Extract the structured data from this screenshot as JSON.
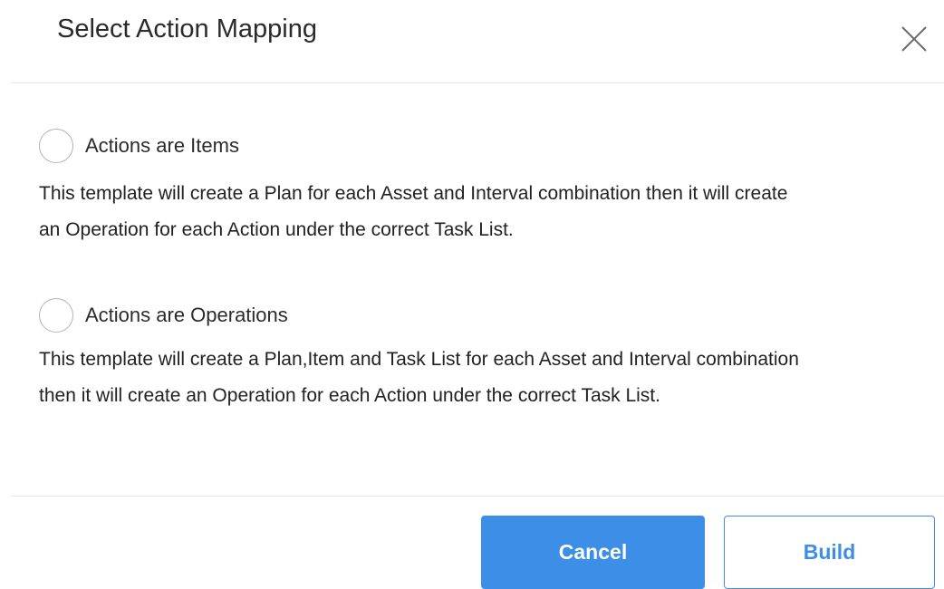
{
  "dialog": {
    "title": "Select Action Mapping",
    "close_icon": "close-icon"
  },
  "options": [
    {
      "label": "Actions are Items",
      "selected": false,
      "description_lines": [
        "This template will create a Plan for each Asset and Interval combination then it will create",
        "an Operation for each Action under the correct Task List."
      ]
    },
    {
      "label": "Actions are Operations",
      "selected": false,
      "description_lines": [
        "This template will create a Plan,Item and Task List for each Asset and Interval combination",
        "then it will create an Operation for each Action under the correct Task List."
      ]
    }
  ],
  "footer": {
    "cancel_label": "Cancel",
    "build_label": "Build"
  },
  "colors": {
    "accent": "#3d8ee6",
    "divider": "#e6e6e6"
  }
}
